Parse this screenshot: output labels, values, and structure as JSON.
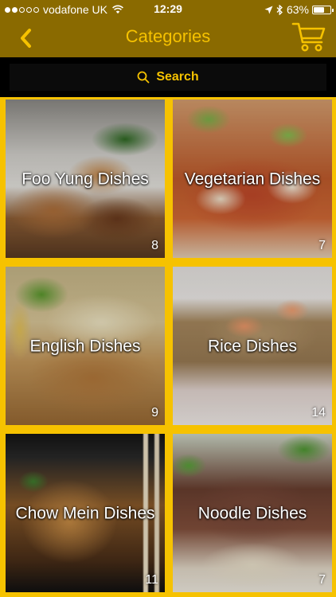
{
  "status_bar": {
    "carrier": "vodafone UK",
    "time": "12:29",
    "battery_percent": "63%",
    "battery_level": 0.63,
    "icons": [
      "signal-dots-icon",
      "wifi-icon",
      "location-arrow-icon",
      "bluetooth-icon",
      "battery-icon"
    ]
  },
  "nav": {
    "title": "Categories",
    "back_icon": "chevron-left-icon",
    "cart_icon": "shopping-cart-icon"
  },
  "search": {
    "label": "Search",
    "icon": "search-icon"
  },
  "categories": [
    {
      "name": "Foo Yung Dishes",
      "count": "8"
    },
    {
      "name": "Vegetarian Dishes",
      "count": "7"
    },
    {
      "name": "English Dishes",
      "count": "9"
    },
    {
      "name": "Rice Dishes",
      "count": "14"
    },
    {
      "name": "Chow Mein Dishes",
      "count": "11"
    },
    {
      "name": "Noodle Dishes",
      "count": "7"
    }
  ],
  "colors": {
    "accent": "#f6c200",
    "bar": "#8a6a00",
    "search_bg": "#000000"
  }
}
